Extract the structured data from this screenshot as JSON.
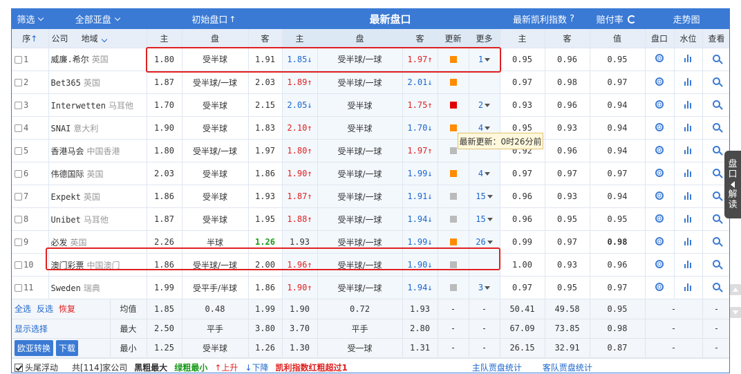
{
  "header": {
    "filter": "筛选",
    "all_handicap": "全部亚盘",
    "initial": "初始盘口",
    "latest": "最新盘口",
    "kelly": "最新凯利指数",
    "kelly_q": "?",
    "payout": "赔付率",
    "trend": "走势图"
  },
  "subheader": {
    "seq": "序",
    "company": "公司",
    "region": "地域",
    "home": "主",
    "handicap": "盘",
    "away": "客",
    "update": "更新",
    "more": "更多",
    "value": "值",
    "pan": "盘口",
    "water": "水位",
    "view": "查看"
  },
  "rows": [
    {
      "idx": "1",
      "company": "威廉.希尔",
      "region": "英国",
      "ih": "1.80",
      "ip": "受半球",
      "ia": "1.91",
      "lh": "1.85",
      "lhd": "↓",
      "lhc": "blue",
      "lp": "受半球/一球",
      "la": "1.97",
      "lad": "↑",
      "lac": "red",
      "sq": "#ff8c00",
      "more": "1",
      "kh": "0.95",
      "ka": "0.96",
      "pay": "0.95",
      "pb": false
    },
    {
      "idx": "2",
      "company": "Bet365",
      "region": "英国",
      "ih": "1.87",
      "ip": "受半球/一球",
      "ia": "2.03",
      "lh": "1.89",
      "lhd": "↑",
      "lhc": "red",
      "lp": "受半球/一球",
      "la": "2.01",
      "lad": "↓",
      "lac": "blue",
      "sq": "#ff8c00",
      "more": "",
      "kh": "0.97",
      "ka": "0.98",
      "pay": "0.97",
      "pb": false
    },
    {
      "idx": "3",
      "company": "Interwetten",
      "region": "马耳他",
      "ih": "1.70",
      "ip": "受半球",
      "ia": "2.15",
      "lh": "2.05",
      "lhd": "↓",
      "lhc": "blue",
      "lp": "受半球",
      "la": "1.75",
      "lad": "↑",
      "lac": "red",
      "sq": "#e00000",
      "more": "2",
      "kh": "0.93",
      "ka": "0.96",
      "pay": "0.94",
      "pb": false
    },
    {
      "idx": "4",
      "company": "SNAI",
      "region": "意大利",
      "ih": "1.90",
      "ip": "受半球",
      "ia": "1.83",
      "lh": "2.10",
      "lhd": "↑",
      "lhc": "red",
      "lp": "受半球",
      "la": "1.70",
      "lad": "↓",
      "lac": "blue",
      "sq": "#ff8c00",
      "more": "4",
      "kh": "0.95",
      "ka": "0.93",
      "pay": "0.94",
      "pb": false
    },
    {
      "idx": "5",
      "company": "香港马会",
      "region": "中国香港",
      "ih": "1.80",
      "ip": "受半球/一球",
      "ia": "1.97",
      "lh": "1.80",
      "lhd": "↑",
      "lhc": "red",
      "lp": "受半球/一球",
      "la": "1.97",
      "lad": "↑",
      "lac": "red",
      "sq": "#bbbbbb",
      "more": "",
      "kh": "0.92",
      "ka": "0.96",
      "pay": "0.94",
      "pb": false
    },
    {
      "idx": "6",
      "company": "伟德国际",
      "region": "英国",
      "ih": "2.03",
      "ip": "受半球",
      "ia": "1.86",
      "lh": "1.90",
      "lhd": "↑",
      "lhc": "red",
      "lp": "受半球/一球",
      "la": "1.99",
      "lad": "↓",
      "lac": "blue",
      "sq": "#ff8c00",
      "more": "4",
      "kh": "0.97",
      "ka": "0.97",
      "pay": "0.97",
      "pb": false
    },
    {
      "idx": "7",
      "company": "Expekt",
      "region": "英国",
      "ih": "1.86",
      "ip": "受半球",
      "ia": "1.93",
      "lh": "1.87",
      "lhd": "↑",
      "lhc": "red",
      "lp": "受半球/一球",
      "la": "1.91",
      "lad": "↓",
      "lac": "blue",
      "sq": "#bbbbbb",
      "more": "15",
      "kh": "0.96",
      "ka": "0.93",
      "pay": "0.94",
      "pb": false
    },
    {
      "idx": "8",
      "company": "Unibet",
      "region": "马耳他",
      "ih": "1.87",
      "ip": "受半球",
      "ia": "1.95",
      "lh": "1.88",
      "lhd": "↑",
      "lhc": "red",
      "lp": "受半球/一球",
      "la": "1.94",
      "lad": "↓",
      "lac": "blue",
      "sq": "#bbbbbb",
      "more": "15",
      "kh": "0.96",
      "ka": "0.95",
      "pay": "0.95",
      "pb": false
    },
    {
      "idx": "9",
      "company": "必发",
      "region": "英国",
      "ih": "2.26",
      "ip": "半球",
      "ia": "1.26",
      "iag": true,
      "lh": "1.93",
      "lhd": "",
      "lhc": "",
      "lp": "受半球/一球",
      "la": "1.99",
      "lad": "↓",
      "lac": "blue",
      "sq": "#ff8c00",
      "more": "26",
      "kh": "0.99",
      "ka": "0.97",
      "pay": "0.98",
      "pb": true
    },
    {
      "idx": "10",
      "company": "澳门彩票",
      "region": "中国澳门",
      "ih": "1.86",
      "ip": "受半球/一球",
      "ia": "2.00",
      "lh": "1.96",
      "lhd": "↑",
      "lhc": "red",
      "lp": "受半球/一球",
      "la": "1.90",
      "lad": "↓",
      "lac": "blue",
      "sq": "#bbbbbb",
      "more": "",
      "kh": "1.00",
      "ka": "0.93",
      "pay": "0.96",
      "pb": false
    },
    {
      "idx": "11",
      "company": "Sweden",
      "region": "瑞典",
      "ih": "1.99",
      "ip": "受平手/半球",
      "ia": "1.86",
      "lh": "1.90",
      "lhd": "↑",
      "lhc": "red",
      "lp": "受半球/一球",
      "la": "1.94",
      "lad": "↓",
      "lac": "blue",
      "sq": "#bbbbbb",
      "more": "3",
      "kh": "0.97",
      "ka": "0.95",
      "pay": "0.97",
      "pb": false
    }
  ],
  "tooltip": "最新更新：0时26分前",
  "footer": {
    "select_all": "全选",
    "invert": "反选",
    "restore": "恢复",
    "show_select": "显示选择",
    "convert": "欧亚转换",
    "download": "下载",
    "avg": {
      "label": "均值",
      "ih": "1.85",
      "ip": "0.48",
      "ia": "1.99",
      "lh": "1.90",
      "lp": "0.72",
      "la": "1.93",
      "u": "-",
      "m": "-",
      "kh": "50.41",
      "ka": "49.58",
      "pay": "0.95",
      "p1": "-",
      "p2": "-",
      "p3": "-"
    },
    "max": {
      "label": "最大",
      "ih": "2.50",
      "ip": "平手",
      "ia": "3.80",
      "lh": "3.70",
      "lp": "平手",
      "la": "2.80",
      "u": "-",
      "m": "-",
      "kh": "67.09",
      "ka": "73.85",
      "pay": "0.98",
      "p1": "-",
      "p2": "-",
      "p3": "-"
    },
    "min": {
      "label": "最小",
      "ih": "1.25",
      "ip": "受半球",
      "ia": "1.26",
      "lh": "1.30",
      "lp": "受一球",
      "la": "1.31",
      "u": "-",
      "m": "-",
      "kh": "26.15",
      "ka": "32.91",
      "pay": "0.87",
      "p1": "-",
      "p2": "-",
      "p3": "-"
    }
  },
  "bottom": {
    "float": "头尾浮动",
    "count": "共[114]家公司",
    "bold_max": "黑粗最大",
    "green_min": "绿粗最小",
    "up": "↑上升",
    "down": "↓下降",
    "kelly_red": "凯利指数红粗超过1",
    "home_stats": "主队贾盘统计",
    "away_stats": "客队贾盘统计"
  },
  "sidetab": "盘口解读",
  "colors": {
    "header_bg": "#3a7ad5",
    "highlight_border": "#e02020",
    "up": "#e02020",
    "down": "#1a66cc",
    "min": "#1a9a1a"
  }
}
